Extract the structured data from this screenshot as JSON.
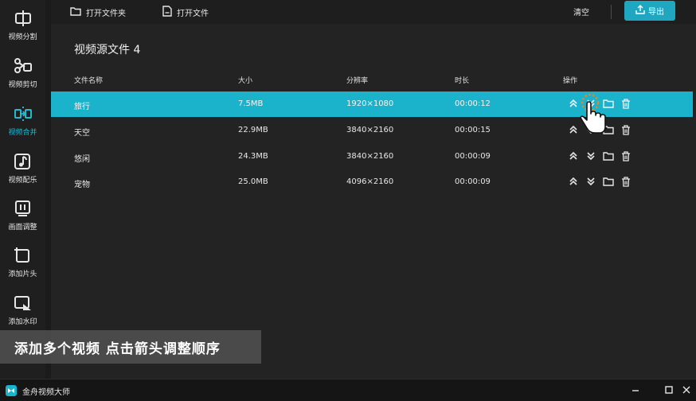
{
  "app": {
    "name": "金舟视频大师"
  },
  "sidebar": {
    "items": [
      {
        "label": "视频分割",
        "icon": "video-split-icon"
      },
      {
        "label": "视频剪切",
        "icon": "scissors-icon"
      },
      {
        "label": "视频合并",
        "icon": "video-merge-icon",
        "active": true
      },
      {
        "label": "视频配乐",
        "icon": "music-note-icon"
      },
      {
        "label": "画面调整",
        "icon": "frame-adjust-icon"
      },
      {
        "label": "添加片头",
        "icon": "add-intro-icon"
      },
      {
        "label": "添加水印",
        "icon": "watermark-icon"
      }
    ]
  },
  "toolbar": {
    "open_folder": "打开文件夹",
    "open_file": "打开文件",
    "clear": "清空",
    "export": "导出"
  },
  "main": {
    "section_title": "视频源文件 4",
    "columns": [
      "文件名称",
      "大小",
      "分辨率",
      "时长",
      "操作"
    ],
    "rows": [
      {
        "name": "旅行",
        "size": "7.5MB",
        "resolution": "1920×1080",
        "duration": "00:00:12",
        "selected": true
      },
      {
        "name": "天空",
        "size": "22.9MB",
        "resolution": "3840×2160",
        "duration": "00:00:15"
      },
      {
        "name": "悠闲",
        "size": "24.3MB",
        "resolution": "3840×2160",
        "duration": "00:00:09"
      },
      {
        "name": "宠物",
        "size": "25.0MB",
        "resolution": "4096×2160",
        "duration": "00:00:09"
      }
    ],
    "row_actions": [
      "move-up-icon",
      "move-down-icon",
      "folder-icon",
      "trash-icon"
    ]
  },
  "caption": "添加多个视频 点击箭头调整顺序",
  "colors": {
    "accent": "#1bb2cb",
    "export_button": "#1fa6c0",
    "background": "#232323",
    "sidebar": "#1f1f1f"
  }
}
